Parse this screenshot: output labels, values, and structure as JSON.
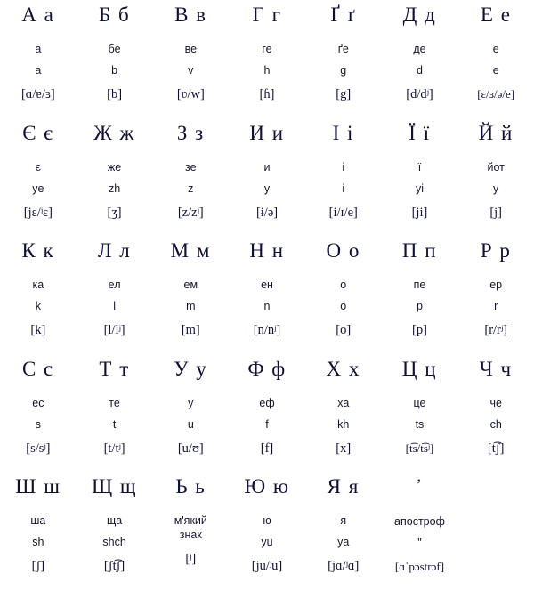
{
  "chart": {
    "title": "Ukrainian alphabet",
    "columns": 7,
    "colors": {
      "background": "#ffffff",
      "letter": "#101036",
      "text": "#15152e"
    },
    "rows": [
      [
        {
          "header": "А а",
          "name": "а",
          "translit": "a",
          "ipa": "[ɑ/ɐ/ɜ]"
        },
        {
          "header": "Б б",
          "name": "бе",
          "translit": "b",
          "ipa": "[b]"
        },
        {
          "header": "В в",
          "name": "ве",
          "translit": "v",
          "ipa": "[ʋ/w]"
        },
        {
          "header": "Г г",
          "name": "ге",
          "translit": "h",
          "ipa": "[ɦ]"
        },
        {
          "header": "Ґ ґ",
          "name": "ґе",
          "translit": "g",
          "ipa": "[g]"
        },
        {
          "header": "Д д",
          "name": "де",
          "translit": "d",
          "ipa": "[d/dʲ]"
        },
        {
          "header": "Е е",
          "name": "е",
          "translit": "e",
          "ipa": "[ɛ/ɜ/ə/e]"
        }
      ],
      [
        {
          "header": "Є є",
          "name": "є",
          "translit": "ye",
          "ipa": "[jɛ/ʲɛ]"
        },
        {
          "header": "Ж ж",
          "name": "же",
          "translit": "zh",
          "ipa": "[ʒ]"
        },
        {
          "header": "З з",
          "name": "зе",
          "translit": "z",
          "ipa": "[z/zʲ]"
        },
        {
          "header": "И и",
          "name": "и",
          "translit": "y",
          "ipa": "[ɨ/ə]"
        },
        {
          "header": "І і",
          "name": "і",
          "translit": "i",
          "ipa": "[i/ɪ/e]"
        },
        {
          "header": "Ї ї",
          "name": "ї",
          "translit": "yi",
          "ipa": "[ji]"
        },
        {
          "header": "Й й",
          "name": "йот",
          "translit": "y",
          "ipa": "[j]"
        }
      ],
      [
        {
          "header": "К к",
          "name": "ка",
          "translit": "k",
          "ipa": "[k]"
        },
        {
          "header": "Л л",
          "name": "ел",
          "translit": "l",
          "ipa": "[l/lʲ]"
        },
        {
          "header": "М м",
          "name": "ем",
          "translit": "m",
          "ipa": "[m]"
        },
        {
          "header": "Н н",
          "name": "ен",
          "translit": "n",
          "ipa": "[n/nʲ]"
        },
        {
          "header": "О о",
          "name": "о",
          "translit": "o",
          "ipa": "[o]"
        },
        {
          "header": "П п",
          "name": "пе",
          "translit": "p",
          "ipa": "[p]"
        },
        {
          "header": "Р р",
          "name": "ер",
          "translit": "r",
          "ipa": "[r/rʲ]"
        }
      ],
      [
        {
          "header": "С с",
          "name": "ес",
          "translit": "s",
          "ipa": "[s/sʲ]"
        },
        {
          "header": "Т т",
          "name": "те",
          "translit": "t",
          "ipa": "[t/tʲ]"
        },
        {
          "header": "У у",
          "name": "у",
          "translit": "u",
          "ipa": "[u/ʊ]"
        },
        {
          "header": "Ф ф",
          "name": "еф",
          "translit": "f",
          "ipa": "[f]"
        },
        {
          "header": "Х х",
          "name": "ха",
          "translit": "kh",
          "ipa": "[x]"
        },
        {
          "header": "Ц ц",
          "name": "це",
          "translit": "ts",
          "ipa": "[t͡s/t͡sʲ]"
        },
        {
          "header": "Ч ч",
          "name": "че",
          "translit": "ch",
          "ipa": "[t͡ʃ]"
        }
      ],
      [
        {
          "header": "Ш ш",
          "name": "ша",
          "translit": "sh",
          "ipa": "[ʃ]"
        },
        {
          "header": "Щ щ",
          "name": "ща",
          "translit": "shch",
          "ipa": "[ʃt͡ʃ]"
        },
        {
          "header": "Ь ь",
          "name": "м'який",
          "translit": "знак",
          "ipa": "[ʲ]"
        },
        {
          "header": "Ю ю",
          "name": "ю",
          "translit": "yu",
          "ipa": "[ju/ʲu]"
        },
        {
          "header": "Я я",
          "name": "я",
          "translit": "ya",
          "ipa": "[jɑ/ʲɑ]"
        },
        {
          "header": "ʼ",
          "name": "апостроф",
          "translit": "\"",
          "ipa": "[ɑˈpɔstrɔf]"
        },
        {
          "header": "",
          "name": "",
          "translit": "",
          "ipa": ""
        }
      ]
    ]
  }
}
